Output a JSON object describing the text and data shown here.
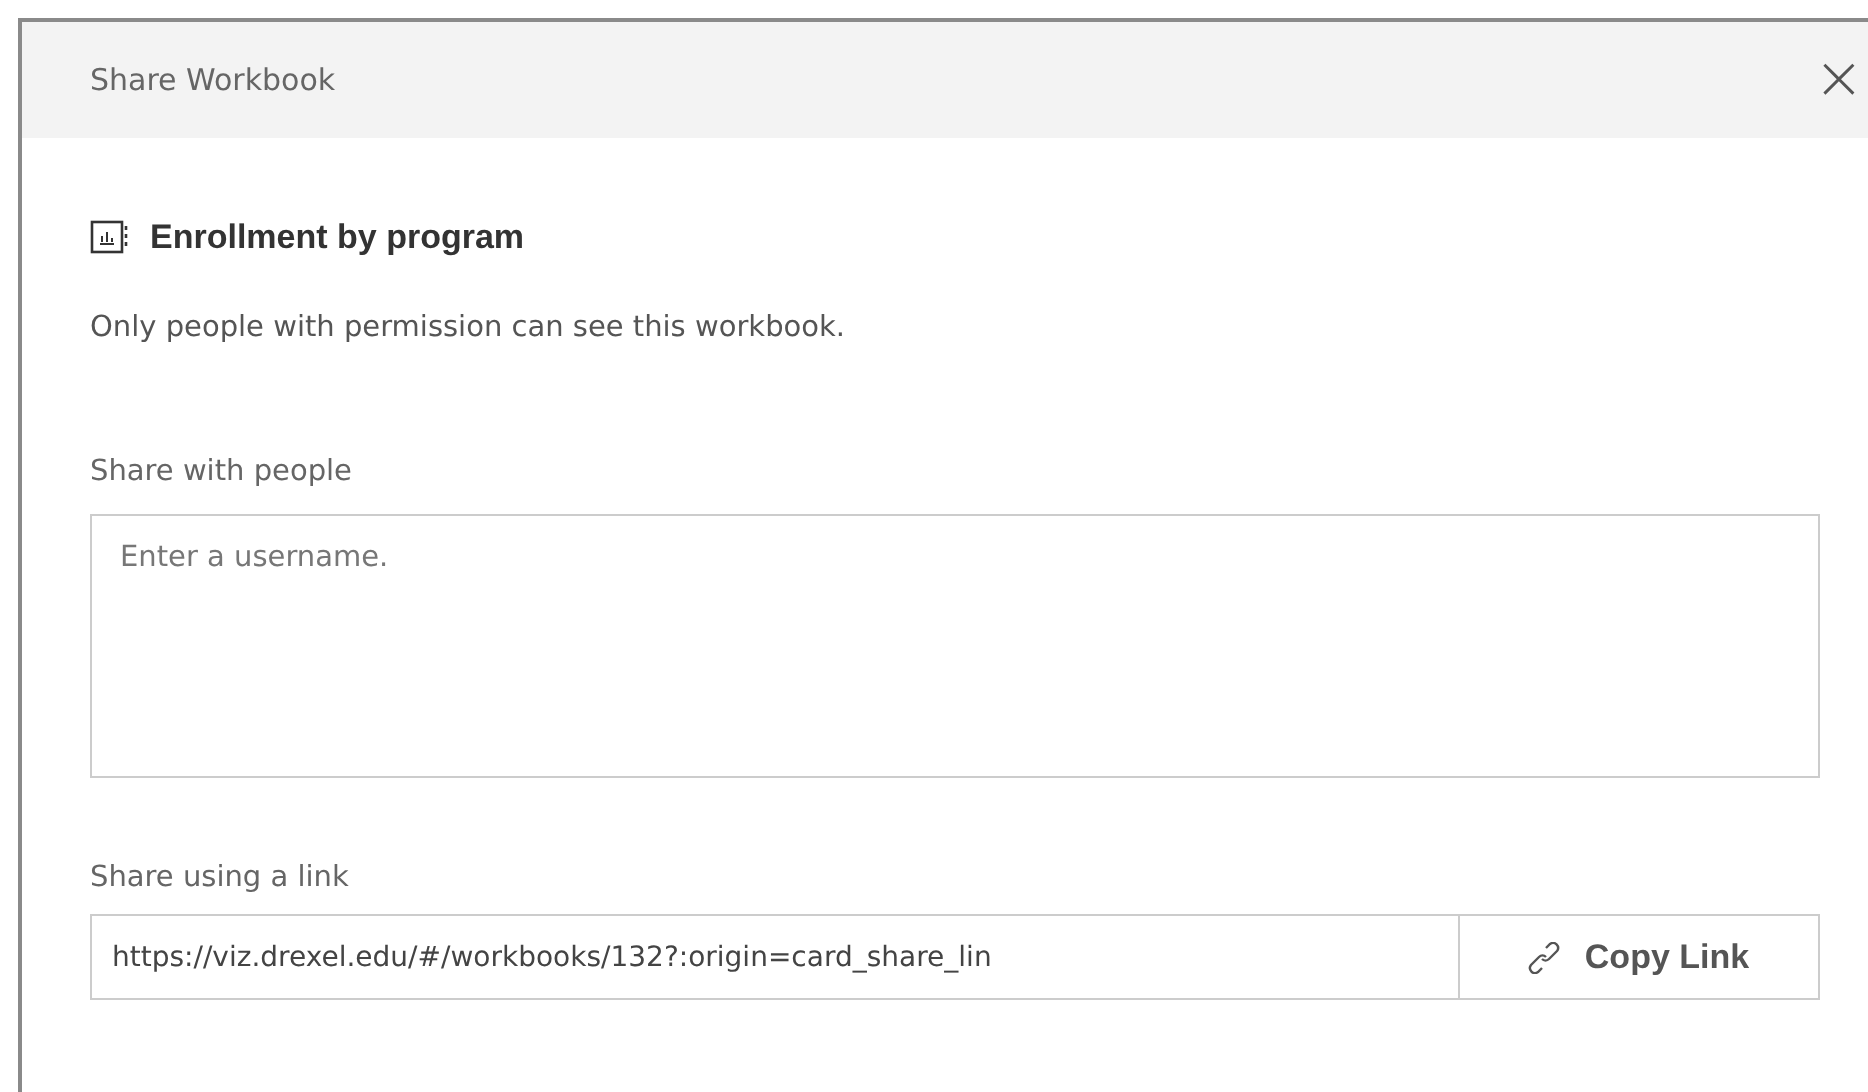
{
  "dialog": {
    "title": "Share Workbook",
    "close": "×"
  },
  "workbook": {
    "name": "Enrollment by program",
    "description": "Only people with permission can see this workbook."
  },
  "share_people": {
    "label": "Share with people",
    "placeholder": "Enter a username."
  },
  "share_link": {
    "label": "Share using a link",
    "value": "https://viz.drexel.edu/#/workbooks/132?:origin=card_share_lin",
    "button": "Copy Link"
  }
}
